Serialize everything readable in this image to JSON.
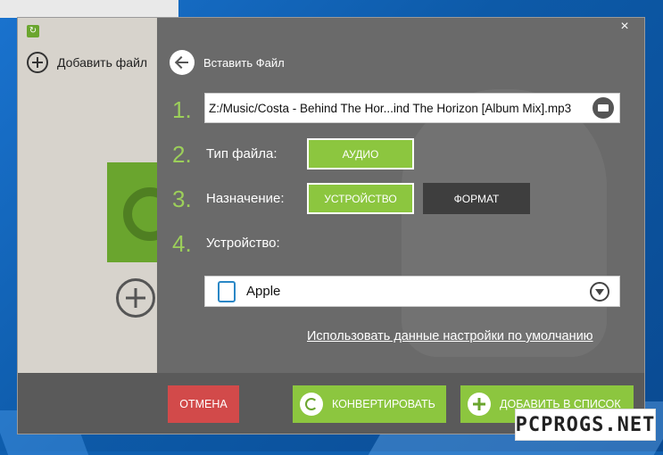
{
  "app": {
    "add_file_label": "Добавить файл"
  },
  "dialog": {
    "back_label": "Вставить Файл",
    "steps": [
      "1.",
      "2.",
      "3.",
      "4."
    ],
    "file_path": "Z:/Music/Costa - Behind The Hor...ind The Horizon [Album Mix].mp3",
    "file_type_label": "Тип файла:",
    "file_type_value": "АУДИО",
    "destination_label": "Назначение:",
    "destination_options": [
      "УСТРОЙСТВО",
      "ФОРМАТ"
    ],
    "device_label": "Устройство:",
    "device_value": "Apple",
    "defaults_link": "Использовать данные настройки по умолчанию",
    "cancel_label": "ОТМЕНА",
    "convert_label": "КОНВЕРТИРОВАТЬ",
    "add_to_list_label": "ДОБАВИТЬ В СПИСОК",
    "close_symbol": "×"
  },
  "watermark": "PCPROGS.NET",
  "colors": {
    "accent_green": "#8cc63f",
    "step_green": "#9ccf5a",
    "cancel_red": "#d24a4a",
    "dialog_gray": "#6a6a6a",
    "dark_button": "#3e3e3e",
    "device_icon_blue": "#2a87c6"
  }
}
